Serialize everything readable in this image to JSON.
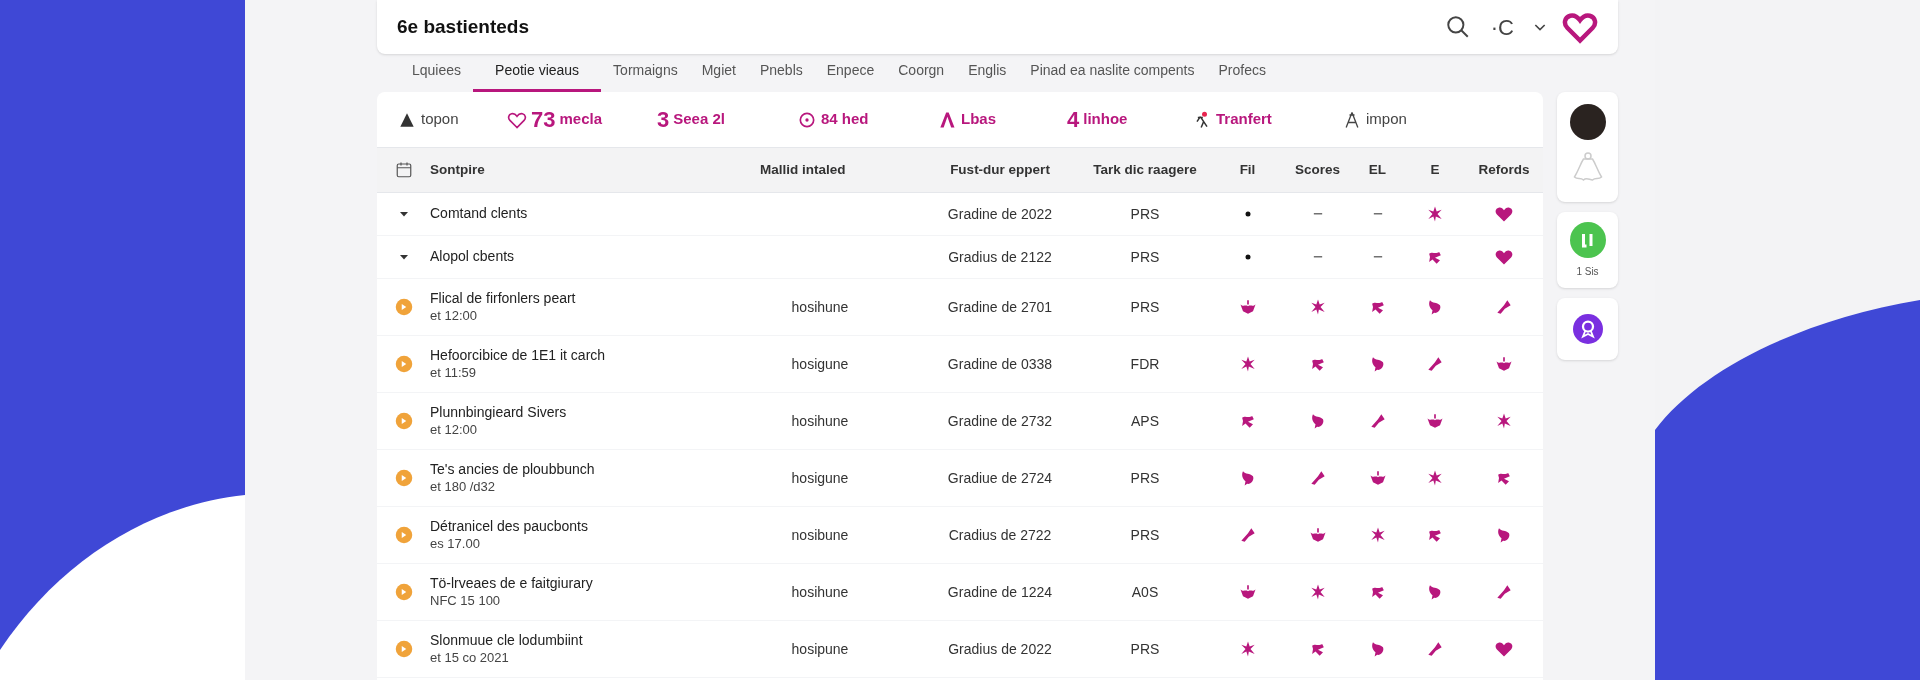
{
  "header": {
    "title": "6e bastienteds",
    "action_text": "·C"
  },
  "tabs": [
    {
      "label": "Lquiees",
      "selected": false
    },
    {
      "label": "Peotie vieaus",
      "selected": true
    },
    {
      "label": "Tormaigns",
      "selected": false
    },
    {
      "label": "Mgiet",
      "selected": false
    },
    {
      "label": "Pnebls",
      "selected": false
    },
    {
      "label": "Enpece",
      "selected": false
    },
    {
      "label": "Coorgn",
      "selected": false
    },
    {
      "label": "Englis",
      "selected": false
    },
    {
      "label": "Pinad ea naslite compents",
      "selected": false
    },
    {
      "label": "Profecs",
      "selected": false
    }
  ],
  "stats": [
    {
      "kind": "muted",
      "label": "topon"
    },
    {
      "kind": "accent",
      "value": "73",
      "label": "mecla"
    },
    {
      "kind": "accent",
      "value": "3",
      "label": "Seea 2l"
    },
    {
      "kind": "accent",
      "label": "84 hed"
    },
    {
      "kind": "accent",
      "label": "Lbas"
    },
    {
      "kind": "accent",
      "value": "4",
      "label": "linhoe"
    },
    {
      "kind": "accent",
      "label": "Tranfert"
    },
    {
      "kind": "muted",
      "label": "impon"
    }
  ],
  "table": {
    "columns": [
      "Sontpire",
      "Mallid intaled",
      "Fust-dur eppert",
      "Tark dic raagere",
      "Fil",
      "Scores",
      "EL",
      "E",
      "Refords"
    ],
    "rows": [
      {
        "kind": "group",
        "name": "Comtand clents",
        "column_3": "Gradine de 2022",
        "column_4": "PRS",
        "cells": [
          {
            "kind": "dot"
          },
          {
            "kind": "dash"
          },
          {
            "kind": "dash"
          },
          {
            "kind": "icon"
          },
          {
            "kind": "heart"
          }
        ]
      },
      {
        "kind": "group",
        "name": "Alopol cbents",
        "column_3": "Gradius de 2122",
        "column_4": "PRS",
        "cells": [
          {
            "kind": "dot"
          },
          {
            "kind": "dash"
          },
          {
            "kind": "dash"
          },
          {
            "kind": "icon"
          },
          {
            "kind": "heart"
          }
        ]
      },
      {
        "kind": "item",
        "name": "Flical de firfonlers peart",
        "sub": "et 12:00",
        "column_2": "hosihune",
        "column_3": "Gradine de 2701",
        "column_4": "PRS",
        "cells": [
          {
            "kind": "icon"
          },
          {
            "kind": "icon"
          },
          {
            "kind": "icon"
          },
          {
            "kind": "icon"
          },
          {
            "kind": "icon"
          }
        ]
      },
      {
        "kind": "item",
        "name": "Hefoorcibice de 1E1 it carch",
        "sub": "et 11:59",
        "column_2": "hosigune",
        "column_3": "Gradine de 0338",
        "column_4": "FDR",
        "cells": [
          {
            "kind": "icon"
          },
          {
            "kind": "icon"
          },
          {
            "kind": "icon"
          },
          {
            "kind": "icon"
          },
          {
            "kind": "icon"
          }
        ]
      },
      {
        "kind": "item",
        "name": "Plunnbingieard Sivers",
        "sub": "et 12:00",
        "column_2": "hosihune",
        "column_3": "Gradine de 2732",
        "column_4": "APS",
        "cells": [
          {
            "kind": "icon"
          },
          {
            "kind": "icon"
          },
          {
            "kind": "icon"
          },
          {
            "kind": "icon"
          },
          {
            "kind": "icon"
          }
        ]
      },
      {
        "kind": "item",
        "name": "Te's ancies de ploubbunch",
        "sub": "et 180 /d32",
        "column_2": "hosigune",
        "column_3": "Gradiue de 2724",
        "column_4": "PRS",
        "cells": [
          {
            "kind": "icon"
          },
          {
            "kind": "icon"
          },
          {
            "kind": "icon"
          },
          {
            "kind": "icon"
          },
          {
            "kind": "icon"
          }
        ]
      },
      {
        "kind": "item",
        "name": "Détranicel des paucbonts",
        "sub": "es 17.00",
        "column_2": "nosibune",
        "column_3": "Cradius de 2722",
        "column_4": "PRS",
        "cells": [
          {
            "kind": "icon"
          },
          {
            "kind": "icon"
          },
          {
            "kind": "icon"
          },
          {
            "kind": "icon"
          },
          {
            "kind": "icon"
          }
        ]
      },
      {
        "kind": "item",
        "name": "Tö-lrveaes de e faitgiurary",
        "sub": "NFC 15 100",
        "column_2": "hosihune",
        "column_3": "Gradine de 1224",
        "column_4": "A0S",
        "cells": [
          {
            "kind": "icon"
          },
          {
            "kind": "icon"
          },
          {
            "kind": "icon"
          },
          {
            "kind": "icon"
          },
          {
            "kind": "icon"
          }
        ]
      },
      {
        "kind": "item",
        "name": "Slonmuue cle lodumbiint",
        "sub": "et 15 co 2021",
        "column_2": "hosipune",
        "column_3": "Gradius de 2022",
        "column_4": "PRS",
        "cells": [
          {
            "kind": "icon"
          },
          {
            "kind": "icon"
          },
          {
            "kind": "icon"
          },
          {
            "kind": "icon"
          },
          {
            "kind": "heart"
          }
        ]
      }
    ]
  },
  "side": {
    "badge_caption": "1 Sis"
  }
}
